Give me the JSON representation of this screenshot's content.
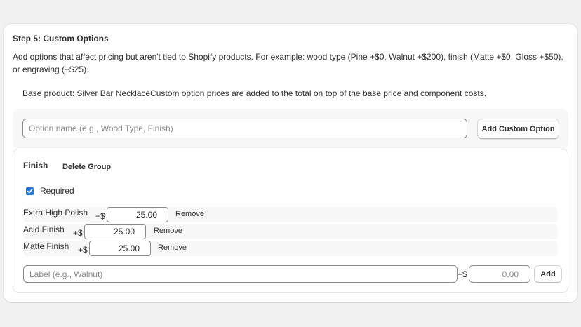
{
  "step": {
    "title": "Step 5: Custom Options",
    "description": "Add options that affect pricing but aren't tied to Shopify products. For example: wood type (Pine +$0, Walnut +$200), finish (Matte +$0, Gloss +$50), or engraving (+$25).",
    "base_product_text": "Base product: Silver Bar NecklaceCustom option prices are added to the total on top of the base price and component costs."
  },
  "add_option": {
    "placeholder": "Option name (e.g., Wood Type, Finish)",
    "value": "",
    "button_label": "Add Custom Option"
  },
  "group": {
    "name": "Finish",
    "delete_label": "Delete Group",
    "required_label": "Required",
    "required_checked": true,
    "values": [
      {
        "label": "Extra High Polish",
        "prefix": "+$",
        "price": "25.00",
        "remove_label": "Remove"
      },
      {
        "label": "Acid Finish",
        "prefix": "+$",
        "price": "25.00",
        "remove_label": "Remove"
      },
      {
        "label": "Matte Finish",
        "prefix": "+$",
        "price": "25.00",
        "remove_label": "Remove"
      }
    ],
    "new_value": {
      "label_placeholder": "Label (e.g., Walnut)",
      "prefix": "+$",
      "price_placeholder": "0.00",
      "add_label": "Add"
    }
  },
  "colors": {
    "checkbox": "#1f7ae0",
    "page_background": "#f1f1f1",
    "panel_background": "#f7f7f7"
  },
  "icons": {
    "checkbox": "checkmark-icon"
  }
}
